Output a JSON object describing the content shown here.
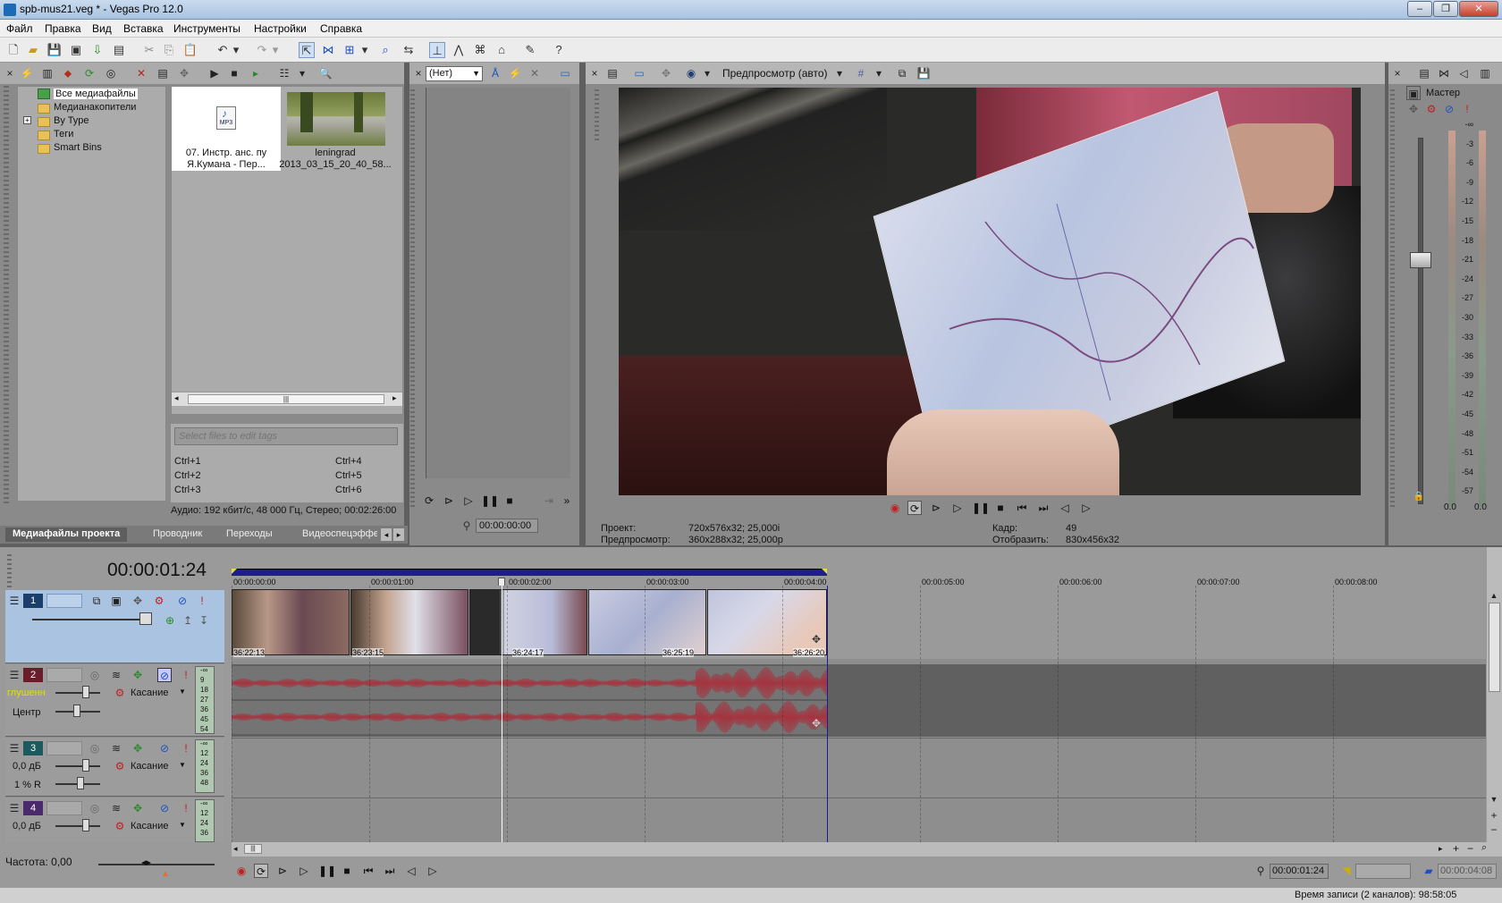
{
  "window": {
    "title": "spb-mus21.veg * - Vegas Pro 12.0"
  },
  "menu": [
    "Файл",
    "Правка",
    "Вид",
    "Вставка",
    "Инструменты",
    "Настройки",
    "Справка"
  ],
  "explorer": {
    "tree": [
      "Все медиафайлы",
      "Медианакопители",
      "By Type",
      "Теги",
      "Smart Bins"
    ],
    "media": [
      {
        "caption1": "07. Инстр. анс. пу",
        "caption2": "Я.Кумана - Пер...",
        "type": "MP3"
      },
      {
        "caption1": "leningrad",
        "caption2": "2013_03_15_20_40_58..."
      }
    ],
    "tags_placeholder": "Select files to edit tags",
    "shortcuts": [
      "Ctrl+1",
      "Ctrl+2",
      "Ctrl+3",
      "Ctrl+4",
      "Ctrl+5",
      "Ctrl+6"
    ],
    "audio_info": "Аудио: 192 кбит/с, 48 000 Гц, Стерео; 00:02:26:00",
    "tabs": [
      "Медиафайлы проекта",
      "Проводник",
      "Переходы",
      "Видеоспецэффе"
    ]
  },
  "trimmer": {
    "select": "(Нет)",
    "timecode": "00:00:00:00"
  },
  "preview": {
    "mode": "Предпросмотр (авто)",
    "project_label": "Проект:",
    "project_value": "720x576x32; 25,000i",
    "preview_label": "Предпросмотр:",
    "preview_value": "360x288x32; 25,000p",
    "frame_label": "Кадр:",
    "frame_value": "49",
    "display_label": "Отобразить:",
    "display_value": "830x456x32"
  },
  "master": {
    "title": "Мастер",
    "scale": [
      "-Inf.",
      "3",
      "6",
      "9",
      "12",
      "15",
      "18",
      "21",
      "24",
      "27",
      "30",
      "33",
      "36",
      "39",
      "42",
      "45",
      "48",
      "51",
      "54",
      "57"
    ],
    "bottom_left": "0.0",
    "bottom_right": "0.0"
  },
  "timeline": {
    "cursor": "00:00:01:24",
    "ruler": [
      "00:00:00:00",
      "00:00:01:00",
      "00:00:02:00",
      "00:00:03:00",
      "00:00:04:00",
      "00:00:05:00",
      "00:00:06:00",
      "00:00:07:00",
      "00:00:08:00"
    ],
    "clips": [
      "36:22:13",
      "36:23:15",
      "36:24:17",
      "36:25:19",
      "36:26:20"
    ],
    "tracks": [
      {
        "num": "1",
        "type": "video"
      },
      {
        "num": "2",
        "type": "audio",
        "vol": "глушенн",
        "pan": "Центр",
        "mode": "Касание",
        "scale": [
          "-Inf.",
          "9",
          "18",
          "27",
          "36",
          "45",
          "54"
        ]
      },
      {
        "num": "3",
        "type": "audio",
        "vol": "0,0 дБ",
        "pan": "1 % R",
        "mode": "Касание",
        "scale": [
          "-Inf.",
          "12",
          "24",
          "36",
          "48"
        ]
      },
      {
        "num": "4",
        "type": "audio",
        "vol": "0,0 дБ",
        "pan": "",
        "mode": "Касание",
        "scale": [
          "-Inf.",
          "12",
          "24",
          "36"
        ]
      }
    ],
    "rate_label": "Частота: 0,00",
    "pos": "00:00:01:24",
    "end": "00:00:04:08"
  },
  "status": "Время записи (2 каналов): 98:58:05",
  "colors": {
    "accent": "#1d1d8f",
    "audio": "#a5343f",
    "video_num": "#1c3e6b"
  }
}
